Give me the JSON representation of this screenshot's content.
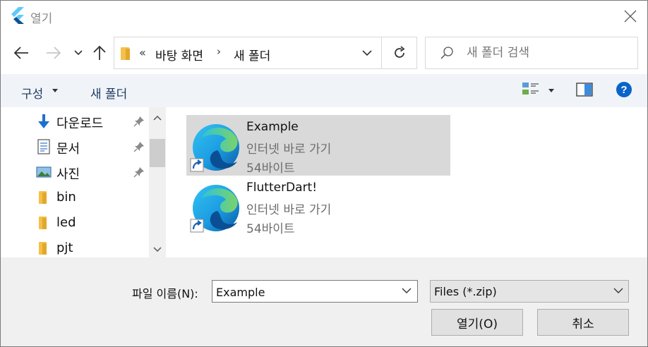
{
  "window": {
    "title": "열기"
  },
  "address": {
    "overflow": "«",
    "crumbs": [
      "바탕 화면",
      "새 폴더"
    ],
    "separator": "›"
  },
  "search": {
    "placeholder": "새 폴더 검색"
  },
  "commandbar": {
    "organize_label": "구성",
    "new_folder_label": "새 폴더"
  },
  "navpane": {
    "items": [
      {
        "label": "다운로드",
        "icon": "download-icon",
        "pinned": true
      },
      {
        "label": "문서",
        "icon": "document-icon",
        "pinned": true
      },
      {
        "label": "사진",
        "icon": "pictures-icon",
        "pinned": true
      },
      {
        "label": "bin",
        "icon": "folder-icon",
        "pinned": false
      },
      {
        "label": "led",
        "icon": "folder-icon",
        "pinned": false
      },
      {
        "label": "pjt",
        "icon": "folder-icon",
        "pinned": false
      }
    ]
  },
  "files": [
    {
      "name": "Example",
      "type": "인터넷 바로 가기",
      "size": "54바이트",
      "selected": true
    },
    {
      "name": "FlutterDart!",
      "type": "인터넷 바로 가기",
      "size": "54바이트",
      "selected": false
    }
  ],
  "bottom": {
    "filename_label": "파일 이름(N):",
    "filename_value": "Example",
    "filetype_value": "Files (*.zip)",
    "open_label": "열기(O)",
    "cancel_label": "취소"
  },
  "colors": {
    "accent": "#0078d7",
    "folder": "#f4c04a",
    "selection": "#d9d9d9",
    "cmdbar": "#f0f4f9"
  }
}
